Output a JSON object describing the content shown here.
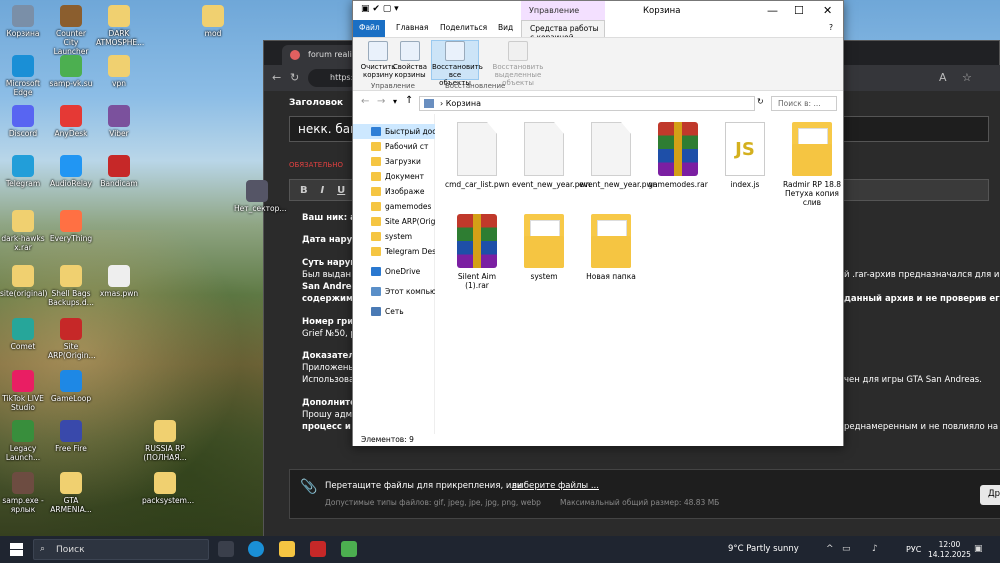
{
  "desktop_icons": [
    {
      "label": "Корзина",
      "color": "#7a8fa8",
      "x": 0
    },
    {
      "label": "Counter City Launcher",
      "color": "#8b5e2e",
      "x": 0
    },
    {
      "label": "DARK ATMOSPHE...",
      "color": "#f0d070",
      "x": 0
    },
    {
      "label": "mod",
      "color": "#f0d070",
      "x": 0
    },
    {
      "label": "Microsoft Edge",
      "color": "#1a8fd6",
      "x": 0
    },
    {
      "label": "samp-vk.su",
      "color": "#4caf50",
      "x": 0
    },
    {
      "label": "vpn",
      "color": "#f0d070",
      "x": 0
    },
    {
      "label": "Discord",
      "color": "#5865f2",
      "x": 0
    },
    {
      "label": "AnyDesk",
      "color": "#e53935",
      "x": 0
    },
    {
      "label": "Viber",
      "color": "#7b519d",
      "x": 0
    },
    {
      "label": "Telegram",
      "color": "#229ed9",
      "x": 0
    },
    {
      "label": "AudioRelay",
      "color": "#2196f3",
      "x": 0
    },
    {
      "label": "Bandicam",
      "color": "#c62828",
      "x": 0
    },
    {
      "label": "Нет_сектор...",
      "color": "#556",
      "x": 0
    },
    {
      "label": "dark-hawks x.rar",
      "color": "#f0d070",
      "x": 0
    },
    {
      "label": "EveryThing",
      "color": "#ff7043",
      "x": 0
    },
    {
      "label": "site(original)",
      "color": "#f0d070",
      "x": 0
    },
    {
      "label": "Shell Bags Backups.d...",
      "color": "#f0d070",
      "x": 0
    },
    {
      "label": "xmas.pwn",
      "color": "#eee",
      "x": 0
    },
    {
      "label": "Comet",
      "color": "#26a69a",
      "x": 0
    },
    {
      "label": "Site ARP(Origin...",
      "color": "#c62828",
      "x": 0
    },
    {
      "label": "TikTok LIVE Studio",
      "color": "#e91e63",
      "x": 0
    },
    {
      "label": "GameLoop",
      "color": "#1e88e5",
      "x": 0
    },
    {
      "label": "Legacy Launch...",
      "color": "#388e3c",
      "x": 0
    },
    {
      "label": "Free Fire",
      "color": "#3949ab",
      "x": 0
    },
    {
      "label": "RUSSIA RP (ПОЛНАЯ...",
      "color": "#f0d070",
      "x": 0
    },
    {
      "label": "samp.exe - ярлык",
      "color": "#6d4c41",
      "x": 0
    },
    {
      "label": "GTA ARMENIA...",
      "color": "#f0d070",
      "x": 0
    },
    {
      "label": "packsystem...",
      "color": "#f0d070",
      "x": 0
    }
  ],
  "browser": {
    "tab_title": "forum realiye",
    "url_text": "https:",
    "forum": {
      "heading": "Заголовок",
      "title_value": "некк. бан",
      "required": "ОБЯЗАТЕЛЬНО",
      "toolbar": [
        "B",
        "I",
        "U"
      ],
      "lines": [
        {
          "text": "Ваш ник: ar",
          "bold": true
        },
        {
          "text": "Дата наруш",
          "bold": true
        },
        {
          "text": "Суть наруш",
          "bold": true
        },
        {
          "text": "Был выдан б",
          "bold": false
        },
        {
          "text": "San Andreas",
          "bold": true
        },
        {
          "text": "содержимо",
          "bold": true
        },
        {
          "text": "Номер гриф",
          "bold": true
        },
        {
          "text": "Grief №50, р",
          "bold": false
        },
        {
          "text": "Доказатель",
          "bold": true
        },
        {
          "text": "Приложены",
          "bold": false
        },
        {
          "text": "Использова",
          "bold": false
        },
        {
          "text": "Дополнител",
          "bold": true
        },
        {
          "text": "Прошу адм",
          "bold": false
        },
        {
          "text": "процесс и бы",
          "bold": true
        }
      ],
      "right_lines": [
        {
          "text": "й .rar-архив предназначался для иг",
          "bold": false
        },
        {
          "text": " данный архив и не проверив его",
          "bold": true
        },
        {
          "text": "чен для игры GTA San Andreas.",
          "bold": false
        },
        {
          "text": "реднамеренным и не повлияло на игр",
          "bold": false
        }
      ],
      "attach_text": "Перетащите файлы для прикрепления, или",
      "attach_link": "выберите файлы ...",
      "allowed_types": "Допустимые типы файлов: gif, jpeg, jpe, jpg, png, webp",
      "max_size": "Максимальный общий размер: 48.83 МБ",
      "other_button": "Другие м"
    }
  },
  "explorer": {
    "context_group": "Управление",
    "window_title": "Корзина",
    "tabs": {
      "file": "Файл",
      "home": "Главная",
      "share": "Поделиться",
      "view": "Вид",
      "tools": "Средства работы с корзиной"
    },
    "ribbon": {
      "empty": "Очистить корзину",
      "props": "Свойства корзины",
      "restore_all": "Восстановить все объекты",
      "restore_sel": "Восстановить выделенные объекты",
      "group_manage": "Управление",
      "group_restore": "Восстановление"
    },
    "address": "Корзина",
    "search_placeholder": "Поиск в: ...",
    "nav": [
      "Быстрый досту",
      "Рабочий ст",
      "Загрузки",
      "Документ",
      "Изображе",
      "gamemodes",
      "Site ARP(Origi",
      "system",
      "Telegram Desk",
      "OneDrive",
      "Этот компьютер",
      "Сеть"
    ],
    "files": [
      {
        "name": "cmd_car_list.pwn",
        "type": "doc"
      },
      {
        "name": "event_new_year.pwn",
        "type": "doc"
      },
      {
        "name": "event_new_year.pwn",
        "type": "doc"
      },
      {
        "name": "gamemodes.rar",
        "type": "rar"
      },
      {
        "name": "index.js",
        "type": "js"
      },
      {
        "name": "Radmir RP 18.8 Петуха копия слив",
        "type": "fold"
      },
      {
        "name": "Silent Aim (1).rar",
        "type": "rar"
      },
      {
        "name": "system",
        "type": "fold"
      },
      {
        "name": "Новая папка",
        "type": "fold"
      }
    ],
    "status": "Элементов: 9"
  },
  "taskbar": {
    "search_placeholder": "Поиск",
    "weather": "9°C  Partly sunny",
    "lang": "РУС",
    "time": "12:00",
    "date": "14.12.2025"
  }
}
